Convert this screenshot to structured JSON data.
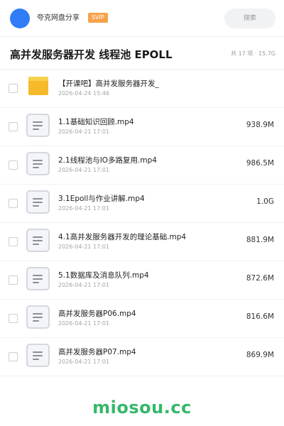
{
  "header": {
    "username": "夸克网盘分享",
    "badge": "SVIP",
    "search_placeholder": "搜索",
    "avatar_color": "#2f7cf6",
    "badge_color": "#f7a24a"
  },
  "folder": {
    "title": "高并发服务器开发 线程池 EPOLL",
    "summary": "共 17 项 · 15.7G"
  },
  "items": [
    {
      "type": "folder",
      "icon": "folder-icon",
      "name": "【开课吧】高并发服务器开发_",
      "date": "2026-04-24 15:46",
      "size": ""
    },
    {
      "type": "file",
      "icon": "video-file-icon",
      "name": "1.1基础知识回顾.mp4",
      "date": "2026-04-21 17:01",
      "size": "938.9M"
    },
    {
      "type": "file",
      "icon": "video-file-icon",
      "name": "2.1线程池与IO多路复用.mp4",
      "date": "2026-04-21 17:01",
      "size": "986.5M"
    },
    {
      "type": "file",
      "icon": "video-file-icon",
      "name": "3.1Epoll与作业讲解.mp4",
      "date": "2026-04-21 17:01",
      "size": "1.0G"
    },
    {
      "type": "file",
      "icon": "video-file-icon",
      "name": "4.1高并发服务器开发的理论基础.mp4",
      "date": "2026-04-21 17:01",
      "size": "881.9M"
    },
    {
      "type": "file",
      "icon": "video-file-icon",
      "name": "5.1数据库及消息队列.mp4",
      "date": "2026-04-21 17:01",
      "size": "872.6M"
    },
    {
      "type": "file",
      "icon": "video-file-icon",
      "name": "高并发服务器P06.mp4",
      "date": "2026-04-21 17:01",
      "size": "816.6M"
    },
    {
      "type": "file",
      "icon": "video-file-icon",
      "name": "高并发服务器P07.mp4",
      "date": "2026-04-21 17:01",
      "size": "869.9M"
    }
  ],
  "watermark": {
    "text": "miosou.cc",
    "color": "#35b86a"
  }
}
